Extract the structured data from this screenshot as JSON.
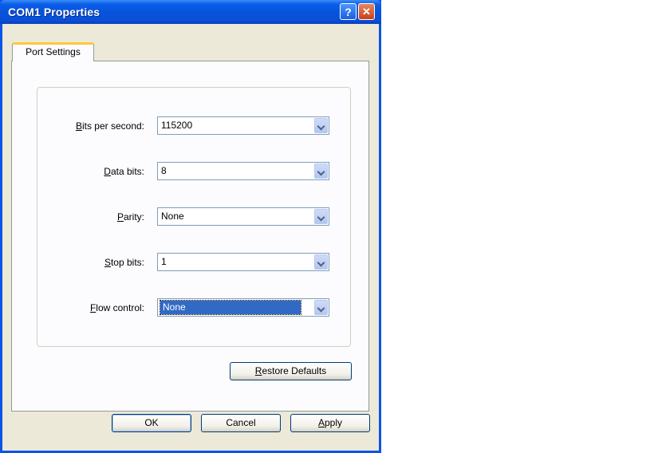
{
  "window": {
    "title": "COM1 Properties",
    "help_glyph": "?",
    "close_glyph": "✕"
  },
  "tabs": [
    {
      "label": "Port Settings",
      "selected": true
    }
  ],
  "fields": {
    "bits_per_second": {
      "label_hotkey": "B",
      "label_rest": "its per second:",
      "value": "115200"
    },
    "data_bits": {
      "label_hotkey": "D",
      "label_rest": "ata bits:",
      "value": "8"
    },
    "parity": {
      "label_hotkey": "P",
      "label_rest": "arity:",
      "value": "None"
    },
    "stop_bits": {
      "label_hotkey": "S",
      "label_rest": "top bits:",
      "value": "1"
    },
    "flow_control": {
      "label_hotkey": "F",
      "label_rest": "low control:",
      "value": "None",
      "focused": true
    }
  },
  "buttons": {
    "restore_hotkey": "R",
    "restore_rest": "estore Defaults",
    "ok": "OK",
    "cancel": "Cancel",
    "apply_hotkey": "A",
    "apply_rest": "pply"
  },
  "colors": {
    "title_bar": "#0a54e6",
    "selection": "#316ac5",
    "tab_highlight": "#ffc83c"
  }
}
